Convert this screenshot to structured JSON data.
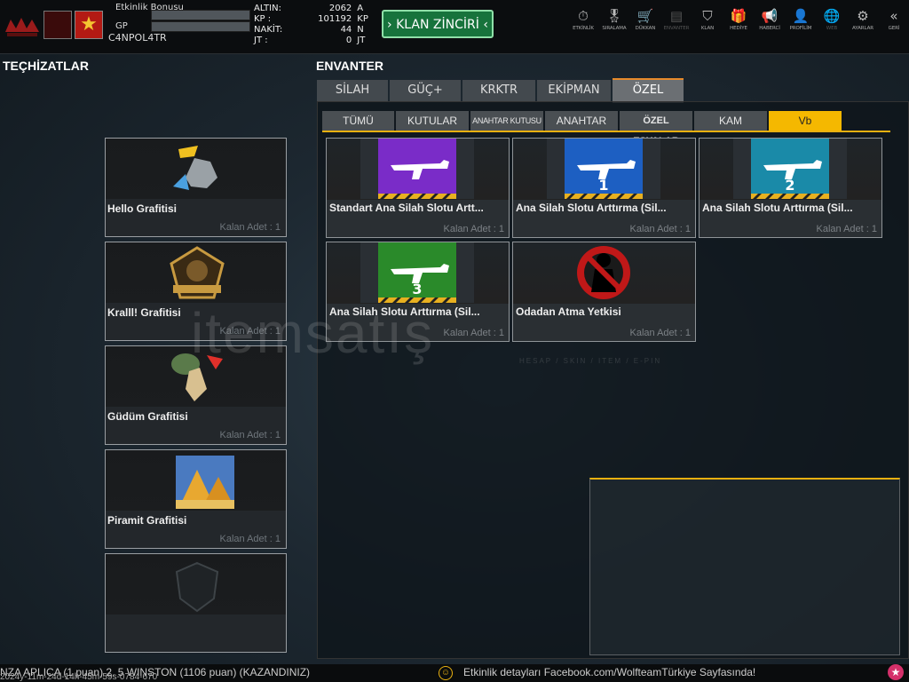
{
  "player": {
    "name": "C4NPOL4TR",
    "event_bonus_label": "Etkinlik Bonusu",
    "gp_label": "GP"
  },
  "currency": [
    {
      "label": "ALTIN:",
      "value": "2062",
      "unit": "A"
    },
    {
      "label": "KP :",
      "value": "101192",
      "unit": "KP"
    },
    {
      "label": "NAKİT:",
      "value": "44",
      "unit": "N"
    },
    {
      "label": "JT :",
      "value": "0",
      "unit": "JT"
    }
  ],
  "clan_chain_button": "KLAN ZİNCİRİ",
  "nav": [
    {
      "label": "ETKİNLİK",
      "icon": "stopwatch-icon",
      "glyph": "⏱",
      "dim": false
    },
    {
      "label": "SIRALAMA",
      "icon": "medal-icon",
      "glyph": "🎖",
      "dim": false
    },
    {
      "label": "DÜKKAN",
      "icon": "cart-icon",
      "glyph": "🛒",
      "dim": false
    },
    {
      "label": "ENVANTER",
      "icon": "inventory-icon",
      "glyph": "▤",
      "dim": true
    },
    {
      "label": "KLAN",
      "icon": "shield-icon",
      "glyph": "⛉",
      "dim": false
    },
    {
      "label": "HEDİYE",
      "icon": "gift-icon",
      "glyph": "🎁",
      "dim": false
    },
    {
      "label": "HABERCİ",
      "icon": "megaphone-icon",
      "glyph": "📢",
      "dim": false
    },
    {
      "label": "PROFİLİM",
      "icon": "profile-icon",
      "glyph": "👤",
      "dim": false
    },
    {
      "label": "WEB",
      "icon": "globe-icon",
      "glyph": "🌐",
      "dim": true
    },
    {
      "label": "AYARLAR",
      "icon": "gear-icon",
      "glyph": "⚙",
      "dim": false
    },
    {
      "label": "GERİ",
      "icon": "back-chevrons-icon",
      "glyph": "«",
      "dim": false
    }
  ],
  "equipment": {
    "title": "TEÇHİZATLAR",
    "items": [
      {
        "name": "Hello Grafitisi",
        "count": "Kalan Adet : 1"
      },
      {
        "name": "Kralll! Grafitisi",
        "count": "Kalan Adet : 1"
      },
      {
        "name": "Güdüm Grafitisi",
        "count": "Kalan Adet : 1"
      },
      {
        "name": "Piramit Grafitisi",
        "count": "Kalan Adet : 1"
      },
      {
        "name": "",
        "count": ""
      }
    ]
  },
  "inventory": {
    "title": "ENVANTER",
    "tabs": [
      "SİLAH",
      "GÜÇ+",
      "KRKTR",
      "EKİPMAN",
      "ÖZEL"
    ],
    "active_tab": "ÖZEL",
    "subtabs": [
      "TÜMÜ",
      "KUTULAR",
      "ANAHTAR KUTUSU",
      "ANAHTAR",
      "ÖZEL EŞYALAR",
      "KAM",
      "Vb"
    ],
    "active_subtab": "Vb",
    "items": [
      {
        "name": "Standart Ana Silah Slotu Artt...",
        "count": "Kalan Adet : 1",
        "badge": "",
        "color": "#7a2cc8"
      },
      {
        "name": "Ana Silah Slotu Arttırma (Sil...",
        "count": "Kalan Adet : 1",
        "badge": "1",
        "color": "#1d5fc2"
      },
      {
        "name": "Ana Silah Slotu Arttırma (Sil...",
        "count": "Kalan Adet : 1",
        "badge": "2",
        "color": "#1a8aa8"
      },
      {
        "name": "Ana Silah Slotu Arttırma (Sil...",
        "count": "Kalan Adet : 1",
        "badge": "3",
        "color": "#2a8a2a"
      },
      {
        "name": "Odadan Atma Yetkisi",
        "count": "Kalan Adet : 1",
        "badge": "",
        "color": "#c01818"
      }
    ]
  },
  "ticker": {
    "left": "NZA APLICA (1 puan) 2. 5 WINSTON (1106 puan) (KAZANDINIZ)",
    "timestamp": "2024y-11m-24d-14h-45m-59s-0784-670",
    "right": "Etkinlik detayları Facebook.com/WolfteamTürkiye Sayfasında!"
  },
  "watermark": {
    "main": "itemsatış",
    "sub": "HESAP / SKIN / ITEM / E-PIN"
  }
}
